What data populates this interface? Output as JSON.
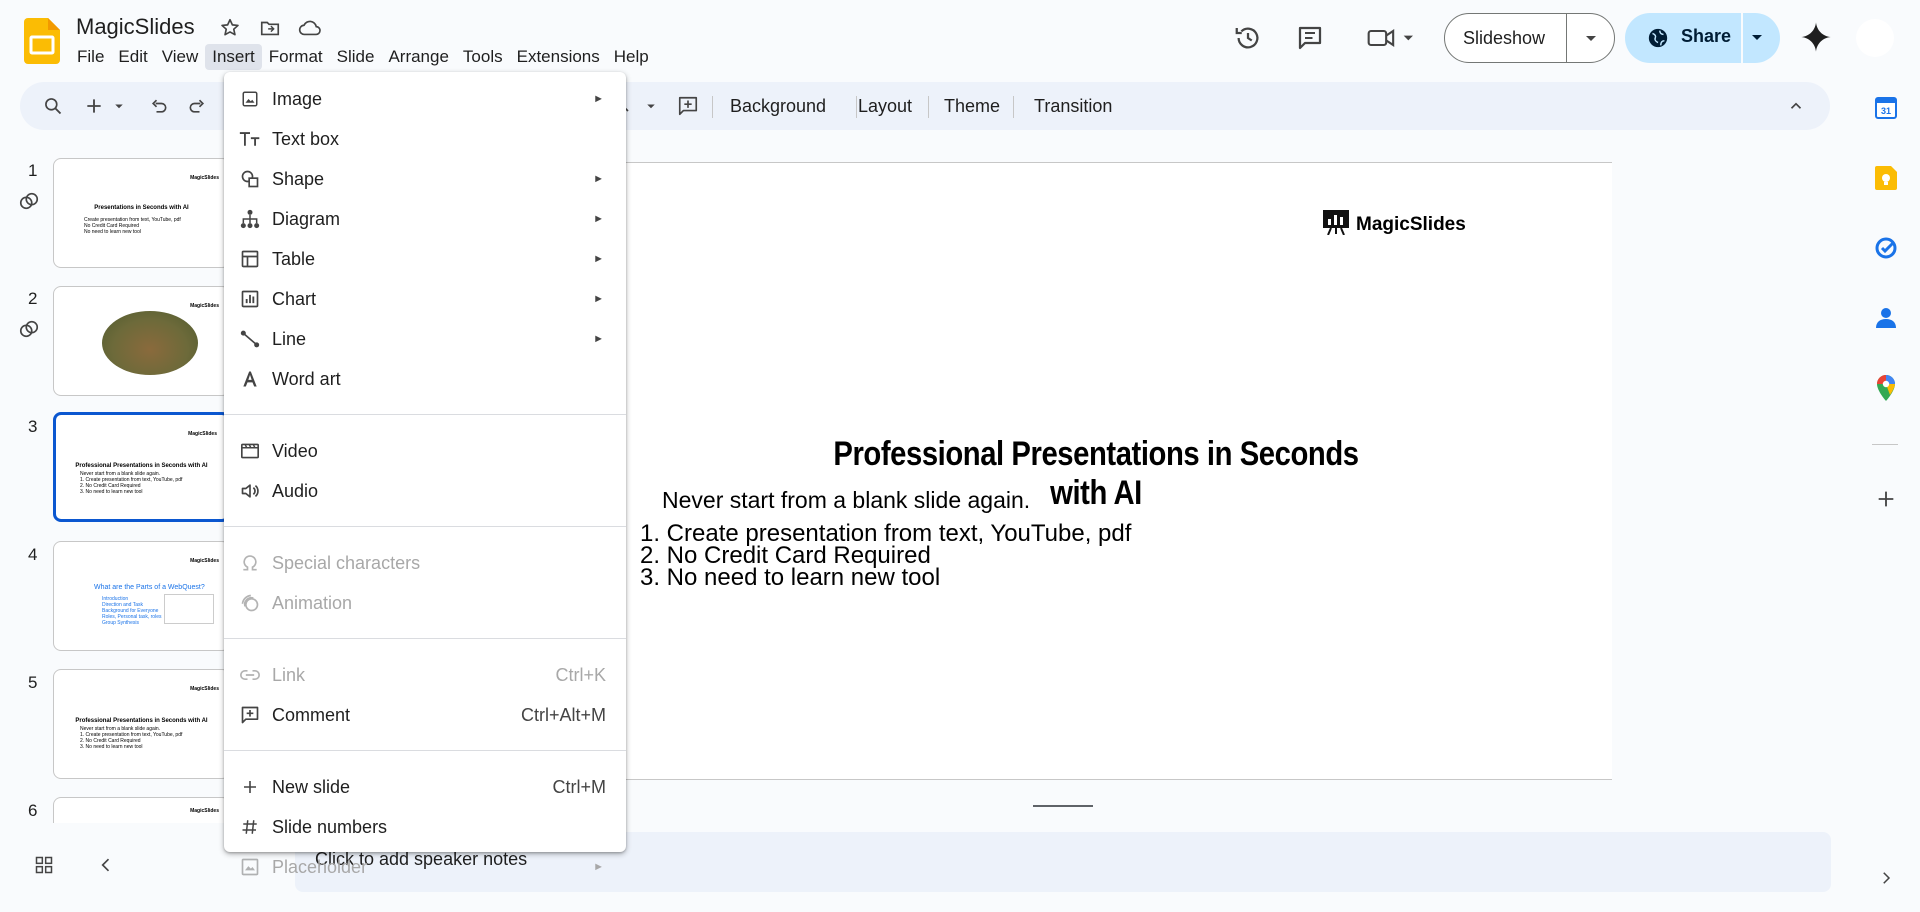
{
  "app": {
    "title": "MagicSlides",
    "menus": [
      "File",
      "Edit",
      "View",
      "Insert",
      "Format",
      "Slide",
      "Arrange",
      "Tools",
      "Extensions",
      "Help"
    ],
    "active_menu": "Insert",
    "slideshow_label": "Slideshow",
    "share_label": "Share",
    "brand_color": "#fbbc04"
  },
  "toolbar": {
    "background_label": "Background",
    "layout_label": "Layout",
    "theme_label": "Theme",
    "transition_label": "Transition"
  },
  "filmstrip": {
    "slides": [
      {
        "number": "1",
        "logo": "MagicSlides",
        "title": "Presentations in Seconds with AI",
        "lines": [
          "Create presentation from text, YouTube, pdf",
          "No Credit Card Required",
          "No need to learn new tool"
        ]
      },
      {
        "number": "2",
        "logo": "MagicSlides"
      },
      {
        "number": "3",
        "logo": "MagicSlides",
        "title": "Professional Presentations in Seconds with AI",
        "lines": [
          "Never start from a blank slide again.",
          "1. Create presentation from text, YouTube, pdf",
          "2. No Credit Card Required",
          "3. No need to learn new tool"
        ]
      },
      {
        "number": "4",
        "logo": "MagicSlides",
        "title": "What are the Parts of a WebQuest?",
        "lines": [
          "Introduction",
          "Direction and Task",
          "Background for Everyone",
          "Roles, Personal task, roles",
          "Group Synthesis"
        ]
      },
      {
        "number": "5",
        "logo": "MagicSlides",
        "title": "Professional Presentations in Seconds with AI",
        "lines": [
          "Never start from a blank slide again.",
          "1. Create presentation from text, YouTube, pdf",
          "2. No Credit Card Required",
          "3. No need to learn new tool"
        ]
      },
      {
        "number": "6",
        "logo": "MagicSlides"
      }
    ]
  },
  "slide": {
    "logo_text": "MagicSlides",
    "title": "Professional Presentations in Seconds with AI",
    "subtitle": "Never start from a blank slide again.",
    "items": [
      "1. Create presentation from text, YouTube, pdf",
      "2. No Credit Card Required",
      "3. No need to learn new tool"
    ]
  },
  "notes": {
    "placeholder": "Click to add speaker notes"
  },
  "insert_menu": {
    "image": "Image",
    "text_box": "Text box",
    "shape": "Shape",
    "diagram": "Diagram",
    "table": "Table",
    "chart": "Chart",
    "line": "Line",
    "word_art": "Word art",
    "video": "Video",
    "audio": "Audio",
    "special_characters": "Special characters",
    "animation": "Animation",
    "link": "Link",
    "link_shortcut": "Ctrl+K",
    "comment": "Comment",
    "comment_shortcut": "Ctrl+Alt+M",
    "new_slide": "New slide",
    "new_slide_shortcut": "Ctrl+M",
    "slide_numbers": "Slide numbers",
    "placeholder": "Placeholder"
  }
}
